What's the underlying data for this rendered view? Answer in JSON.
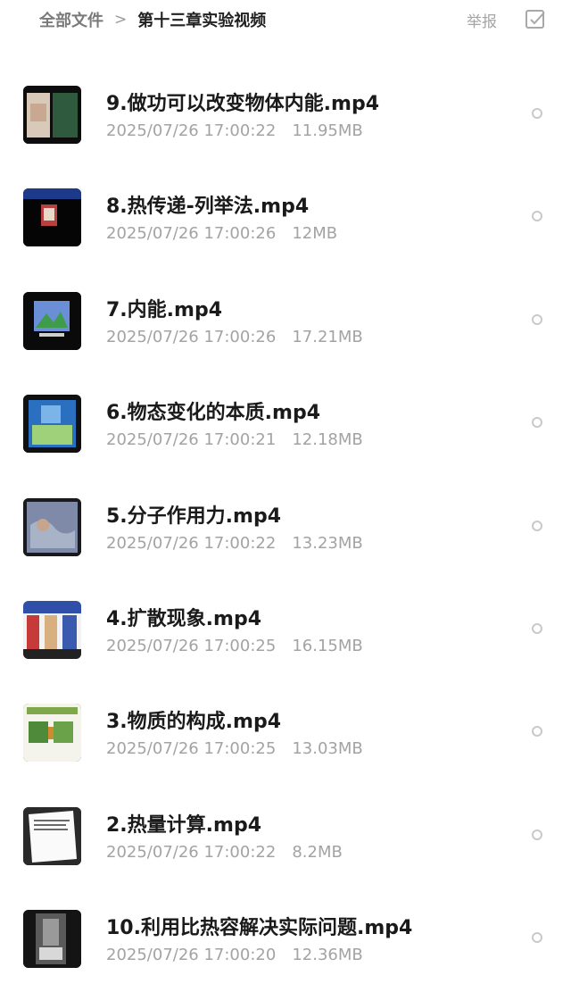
{
  "header": {
    "breadcrumb_root": "全部文件",
    "breadcrumb_separator": ">",
    "breadcrumb_current": "第十三章实验视频",
    "report_label": "举报",
    "select_icon": "checkbox-select-icon"
  },
  "files": [
    {
      "name": "9.做功可以改变物体内能.mp4",
      "date": "2025/07/26 17:00:22",
      "size": "11.95MB"
    },
    {
      "name": "8.热传递-列举法.mp4",
      "date": "2025/07/26 17:00:26",
      "size": "12MB"
    },
    {
      "name": "7.内能.mp4",
      "date": "2025/07/26 17:00:26",
      "size": "17.21MB"
    },
    {
      "name": "6.物态变化的本质.mp4",
      "date": "2025/07/26 17:00:21",
      "size": "12.18MB"
    },
    {
      "name": "5.分子作用力.mp4",
      "date": "2025/07/26 17:00:22",
      "size": "13.23MB"
    },
    {
      "name": "4.扩散现象.mp4",
      "date": "2025/07/26 17:00:25",
      "size": "16.15MB"
    },
    {
      "name": "3.物质的构成.mp4",
      "date": "2025/07/26 17:00:25",
      "size": "13.03MB"
    },
    {
      "name": "2.热量计算.mp4",
      "date": "2025/07/26 17:00:22",
      "size": "8.2MB"
    },
    {
      "name": "10.利用比热容解决实际问题.mp4",
      "date": "2025/07/26 17:00:20",
      "size": "12.36MB"
    }
  ]
}
